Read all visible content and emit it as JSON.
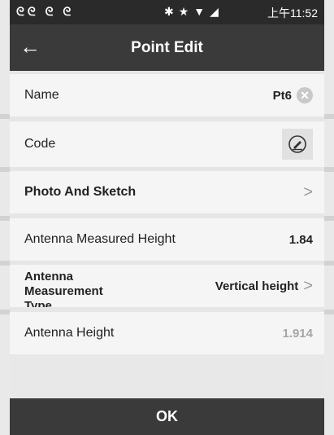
{
  "status": {
    "left_icons": "ᘓᘓ ᘓ ᘓ",
    "mid_icons": "✱★▼◢",
    "time": "上午11:52"
  },
  "header": {
    "title": "Point Edit"
  },
  "fields": {
    "name": {
      "label": "Name",
      "value": "Pt6"
    },
    "code": {
      "label": "Code"
    },
    "photo": {
      "label": "Photo And Sketch"
    },
    "antenna_measured_height": {
      "label": "Antenna Measured Height",
      "value": "1.84"
    },
    "antenna_measurement_type": {
      "label_line1": "Antenna",
      "label_line2": "Measurement",
      "label_line3": "Type",
      "value": "Vertical height"
    },
    "antenna_height": {
      "label": "Antenna Height",
      "value": "1.914"
    }
  },
  "footer": {
    "ok_label": "OK"
  }
}
